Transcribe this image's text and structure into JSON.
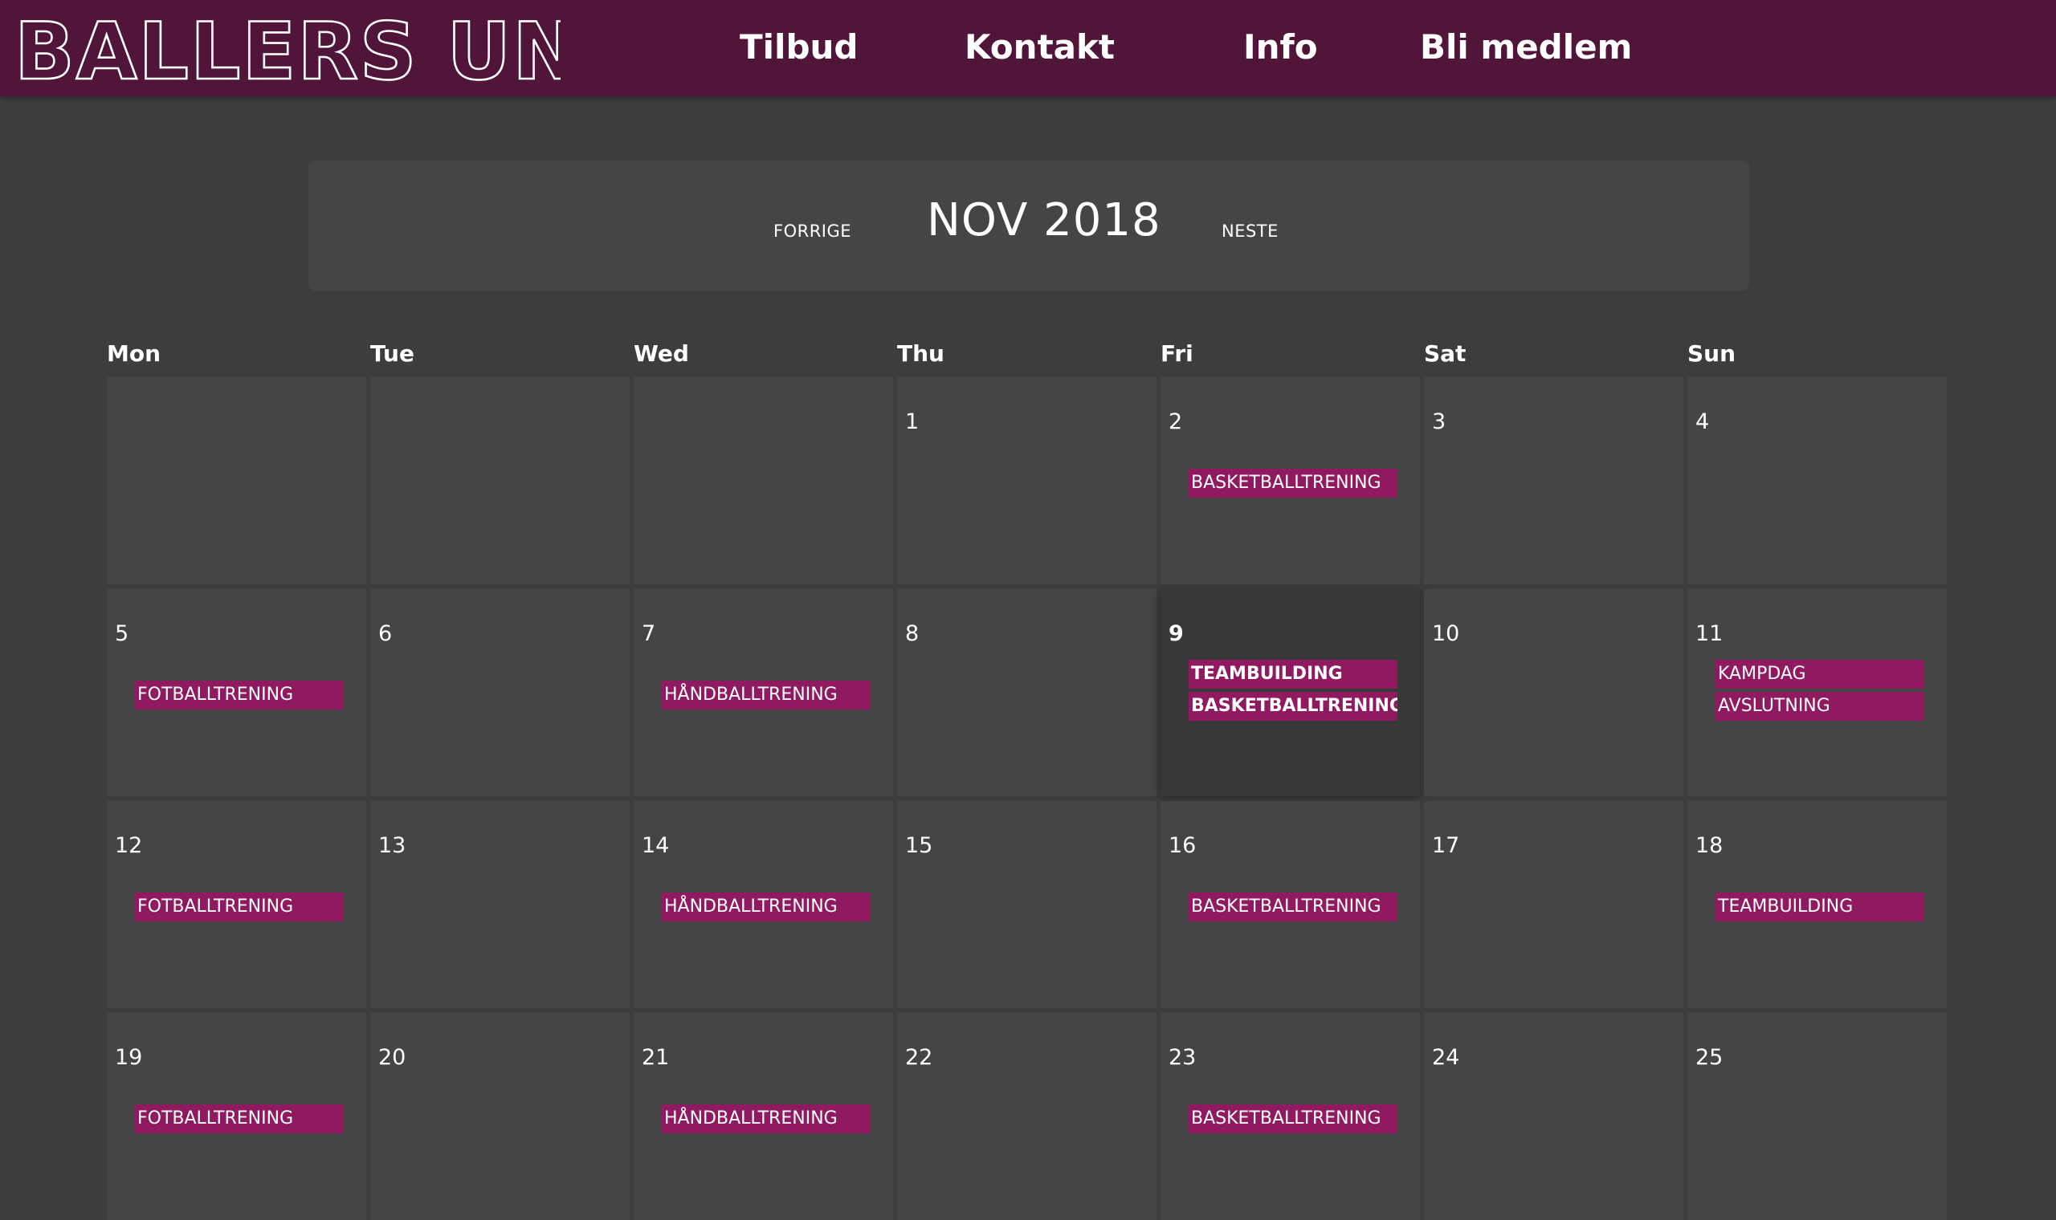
{
  "header": {
    "logo_text": "BALLERS UNITED",
    "nav": [
      {
        "label": "Tilbud"
      },
      {
        "label": "Kontakt"
      },
      {
        "label": "Info"
      },
      {
        "label": "Bli medlem"
      }
    ]
  },
  "calendar": {
    "prev_label": "FORRIGE",
    "title": "NOV 2018",
    "next_label": "NESTE",
    "day_names": [
      "Mon",
      "Tue",
      "Wed",
      "Thu",
      "Fri",
      "Sat",
      "Sun"
    ],
    "weeks": [
      [
        {
          "day": "",
          "events": []
        },
        {
          "day": "",
          "events": []
        },
        {
          "day": "",
          "events": []
        },
        {
          "day": "1",
          "events": []
        },
        {
          "day": "2",
          "events": [
            "BASKETBALLTRENING"
          ]
        },
        {
          "day": "3",
          "events": []
        },
        {
          "day": "4",
          "events": []
        }
      ],
      [
        {
          "day": "5",
          "events": [
            "FOTBALLTRENING"
          ]
        },
        {
          "day": "6",
          "events": []
        },
        {
          "day": "7",
          "events": [
            "HÅNDBALLTRENING"
          ]
        },
        {
          "day": "8",
          "events": []
        },
        {
          "day": "9",
          "today": true,
          "events": [
            "TEAMBUILDING",
            "BASKETBALLTRENING"
          ]
        },
        {
          "day": "10",
          "events": []
        },
        {
          "day": "11",
          "events": [
            "KAMPDAG",
            "AVSLUTNING"
          ]
        }
      ],
      [
        {
          "day": "12",
          "events": [
            "FOTBALLTRENING"
          ]
        },
        {
          "day": "13",
          "events": []
        },
        {
          "day": "14",
          "events": [
            "HÅNDBALLTRENING"
          ]
        },
        {
          "day": "15",
          "events": []
        },
        {
          "day": "16",
          "events": [
            "BASKETBALLTRENING"
          ]
        },
        {
          "day": "17",
          "events": []
        },
        {
          "day": "18",
          "events": [
            "TEAMBUILDING"
          ]
        }
      ],
      [
        {
          "day": "19",
          "events": [
            "FOTBALLTRENING"
          ]
        },
        {
          "day": "20",
          "events": []
        },
        {
          "day": "21",
          "events": [
            "HÅNDBALLTRENING"
          ]
        },
        {
          "day": "22",
          "events": []
        },
        {
          "day": "23",
          "events": [
            "BASKETBALLTRENING"
          ]
        },
        {
          "day": "24",
          "events": []
        },
        {
          "day": "25",
          "events": []
        }
      ]
    ]
  }
}
